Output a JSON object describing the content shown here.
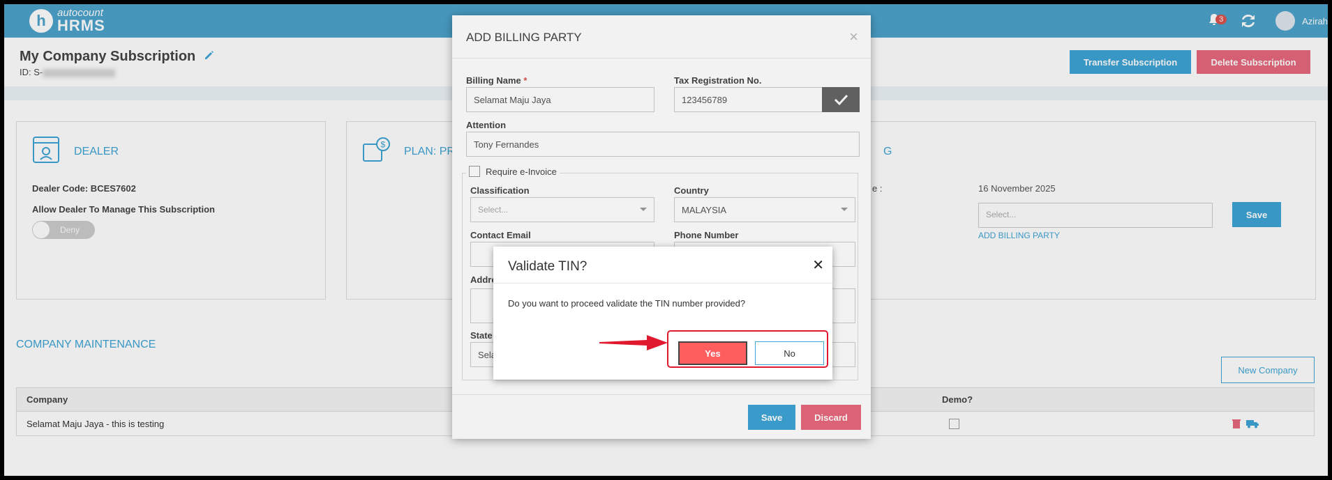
{
  "app": {
    "logo_sub": "autocount",
    "logo_main": "HRMS",
    "notification_count": "3",
    "user_name": "Azirah"
  },
  "page": {
    "title": "My Company Subscription",
    "id_prefix": "ID: S-",
    "transfer_label": "Transfer Subscription",
    "delete_label": "Delete Subscription"
  },
  "dealer": {
    "title": "DEALER",
    "code": "Dealer Code: BCES7602",
    "allow_label": "Allow Dealer To Manage This Subscription",
    "toggle_text": "Deny"
  },
  "plan": {
    "title": "PLAN: PR"
  },
  "billing": {
    "title": "G",
    "date_label": "e :",
    "date": "16 November 2025",
    "select_placeholder": "Select...",
    "add_link": "ADD BILLING PARTY",
    "save_label": "Save"
  },
  "maintenance": {
    "title": "COMPANY MAINTENANCE",
    "new_company_label": "New Company",
    "columns": {
      "company": "Company",
      "demo": "Demo?"
    },
    "rows": [
      {
        "company": "Selamat Maju Jaya - this is testing"
      }
    ]
  },
  "modal": {
    "title": "ADD BILLING PARTY",
    "billing_name_label": "Billing Name",
    "billing_name_value": "Selamat Maju Jaya",
    "tax_label": "Tax Registration No.",
    "tax_value": "123456789",
    "attention_label": "Attention",
    "attention_value": "Tony Fernandes",
    "einvoice_label": "Require e-Invoice",
    "classification_label": "Classification",
    "classification_placeholder": "Select...",
    "country_label": "Country",
    "country_value": "MALAYSIA",
    "email_label": "Contact Email",
    "phone_label": "Phone Number",
    "address_label": "Addre",
    "state_label": "State",
    "state_value": "Selar",
    "save_label": "Save",
    "discard_label": "Discard"
  },
  "confirm": {
    "title": "Validate TIN?",
    "message": "Do you want to proceed validate the TIN number provided?",
    "yes_label": "Yes",
    "no_label": "No"
  },
  "colors": {
    "header": "#4da3cd",
    "primary": "#3ea4d6",
    "danger": "#e8697d",
    "yes": "#ff5e5e",
    "annotation": "#e0192f"
  }
}
